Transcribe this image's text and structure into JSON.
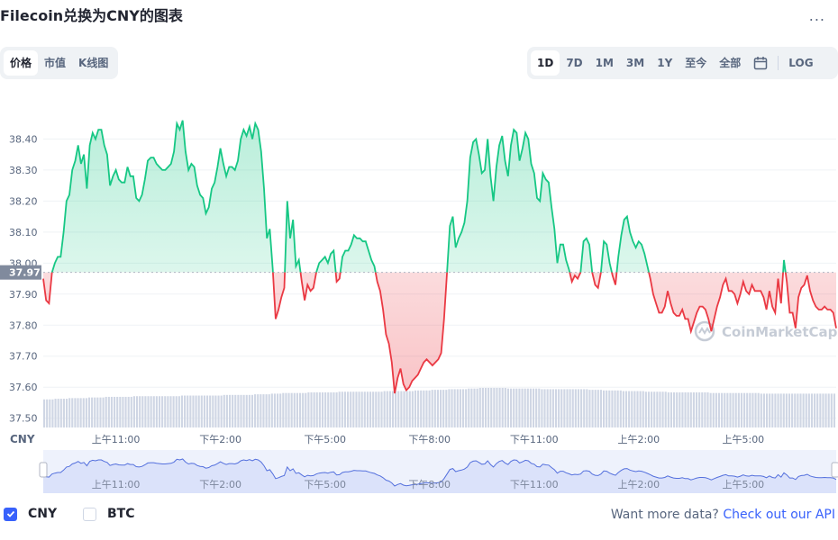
{
  "header": {
    "title": "Filecoin兑换为CNY的图表",
    "more_label": "..."
  },
  "tabs_left": [
    "价格",
    "市值",
    "K线图"
  ],
  "tabs_left_active": 0,
  "tabs_right": [
    "1D",
    "7D",
    "1M",
    "3M",
    "1Y",
    "至今",
    "全部"
  ],
  "tabs_right_active": 0,
  "calendar_icon": "calendar-icon",
  "log_label": "LOG",
  "watermark": "CoinMarketCap",
  "legend": {
    "cny_label": "CNY",
    "btc_label": "BTC",
    "cny_checked": true,
    "btc_checked": false
  },
  "footer": {
    "prompt": "Want more data?",
    "link": "Check out our API"
  },
  "colors": {
    "up": "#16c784",
    "down": "#ea3943",
    "nav_line": "#5470dd",
    "nav_fill": "#e4e9fb",
    "accent": "#3861fb"
  },
  "chart_data": {
    "type": "line",
    "y_axis_unit": "CNY",
    "yticks": [
      "38.40",
      "38.30",
      "38.20",
      "38.10",
      "38.00",
      "37.90",
      "37.80",
      "37.70",
      "37.60",
      "37.50"
    ],
    "ylim": [
      37.47,
      38.5
    ],
    "reference_price": 37.97,
    "reference_label": "37.97",
    "x_labels": [
      "上午11:00",
      "下午2:00",
      "下午5:00",
      "下午8:00",
      "下午11:00",
      "上午2:00",
      "上午5:00"
    ],
    "x_label_index": [
      25,
      61,
      97,
      133,
      169,
      205,
      241
    ],
    "price_series": [
      37.95,
      37.88,
      37.87,
      37.97,
      38.0,
      38.02,
      38.02,
      38.1,
      38.2,
      38.22,
      38.3,
      38.33,
      38.38,
      38.32,
      38.35,
      38.24,
      38.38,
      38.42,
      38.4,
      38.43,
      38.43,
      38.38,
      38.35,
      38.25,
      38.28,
      38.3,
      38.27,
      38.26,
      38.26,
      38.31,
      38.28,
      38.28,
      38.21,
      38.2,
      38.22,
      38.27,
      38.33,
      38.34,
      38.34,
      38.32,
      38.31,
      38.3,
      38.3,
      38.31,
      38.32,
      38.36,
      38.45,
      38.43,
      38.46,
      38.36,
      38.3,
      38.32,
      38.31,
      38.25,
      38.22,
      38.21,
      38.16,
      38.18,
      38.24,
      38.26,
      38.31,
      38.37,
      38.32,
      38.28,
      38.31,
      38.31,
      38.3,
      38.33,
      38.4,
      38.43,
      38.41,
      38.44,
      38.4,
      38.45,
      38.43,
      38.36,
      38.24,
      38.08,
      38.11,
      37.98,
      37.82,
      37.85,
      37.89,
      37.92,
      38.2,
      38.08,
      38.14,
      37.99,
      38.01,
      37.94,
      37.88,
      37.93,
      37.91,
      37.92,
      37.97,
      38.0,
      38.01,
      38.02,
      38.0,
      38.03,
      38.04,
      37.94,
      37.95,
      38.02,
      38.04,
      38.04,
      38.06,
      38.09,
      38.08,
      38.08,
      38.07,
      38.07,
      38.04,
      38.01,
      37.99,
      37.94,
      37.91,
      37.85,
      37.77,
      37.74,
      37.68,
      37.58,
      37.63,
      37.66,
      37.61,
      37.59,
      37.6,
      37.62,
      37.63,
      37.64,
      37.66,
      37.68,
      37.69,
      37.68,
      37.67,
      37.68,
      37.69,
      37.71,
      37.82,
      37.97,
      38.12,
      38.15,
      38.05,
      38.08,
      38.1,
      38.13,
      38.2,
      38.34,
      38.39,
      38.4,
      38.35,
      38.29,
      38.3,
      38.4,
      38.28,
      38.2,
      38.31,
      38.38,
      38.41,
      38.33,
      38.28,
      38.38,
      38.43,
      38.42,
      38.33,
      38.37,
      38.42,
      38.4,
      38.32,
      38.29,
      38.21,
      38.2,
      38.29,
      38.27,
      38.26,
      38.18,
      38.11,
      38.0,
      38.06,
      38.06,
      38.01,
      37.98,
      37.94,
      37.96,
      37.95,
      37.97,
      38.07,
      38.08,
      38.06,
      37.97,
      37.93,
      37.92,
      37.97,
      38.07,
      38.06,
      38.0,
      37.96,
      37.93,
      38.02,
      38.09,
      38.14,
      38.15,
      38.1,
      38.07,
      38.05,
      38.07,
      38.06,
      38.03,
      37.99,
      37.95,
      37.9,
      37.87,
      37.84,
      37.84,
      37.86,
      37.91,
      37.87,
      37.84,
      37.83,
      37.83,
      37.85,
      37.82,
      37.82,
      37.78,
      37.81,
      37.84,
      37.86,
      37.86,
      37.85,
      37.82,
      37.78,
      37.82,
      37.86,
      37.89,
      37.93,
      37.95,
      37.91,
      37.91,
      37.9,
      37.87,
      37.9,
      37.94,
      37.91,
      37.9,
      37.93,
      37.91,
      37.91,
      37.91,
      37.89,
      37.85,
      37.91,
      37.86,
      37.84,
      37.95,
      37.87,
      38.01,
      37.94,
      37.84,
      37.84,
      37.79,
      37.89,
      37.92,
      37.93,
      37.96,
      37.91,
      37.88,
      37.86,
      37.85,
      37.85,
      37.86,
      37.85,
      37.85,
      37.84,
      37.79
    ],
    "volume_series": [
      44,
      44,
      44,
      44,
      45,
      45,
      45,
      45,
      45,
      46,
      46,
      46,
      46,
      46,
      46,
      46,
      47,
      47,
      47,
      47,
      47,
      47,
      48,
      48,
      48,
      48,
      48,
      48,
      48,
      48,
      48,
      48,
      49,
      49,
      49,
      49,
      49,
      49,
      49,
      49,
      49,
      49,
      49,
      49,
      49,
      49,
      49,
      49,
      49,
      50,
      50,
      50,
      50,
      50,
      50,
      50,
      50,
      50,
      50,
      50,
      50,
      50,
      50,
      50,
      51,
      51,
      51,
      51,
      51,
      51,
      51,
      51,
      51,
      51,
      51,
      52,
      52,
      52,
      52,
      52,
      52,
      53,
      53,
      53,
      53,
      54,
      54,
      54,
      54,
      54,
      54,
      54,
      54,
      54,
      55,
      55,
      55,
      55,
      55,
      55,
      55,
      55,
      55,
      55,
      55,
      56,
      56,
      56,
      56,
      56,
      56,
      56,
      56,
      56,
      56,
      56,
      56,
      56,
      56,
      56,
      56,
      57,
      57,
      57,
      57,
      57,
      57,
      57,
      57,
      57,
      57,
      57,
      58,
      58,
      58,
      58,
      58,
      58,
      59,
      59,
      59,
      59,
      59,
      59,
      60,
      60,
      60,
      60,
      60,
      60,
      60,
      61,
      61,
      61,
      61,
      62,
      62,
      62,
      62,
      62,
      62,
      62,
      62,
      62,
      62,
      61,
      61,
      61,
      61,
      61,
      61,
      61,
      61,
      61,
      61,
      61,
      61,
      60,
      60,
      60,
      60,
      60,
      60,
      60,
      60,
      60,
      60,
      60,
      60,
      60,
      60,
      60,
      60,
      60,
      59,
      59,
      59,
      59,
      59,
      58,
      58,
      58,
      58,
      58,
      58,
      58,
      57,
      57,
      57,
      57,
      57,
      57,
      57,
      57,
      56,
      56,
      56,
      56,
      56,
      56,
      56,
      56,
      55,
      55,
      55,
      55,
      55,
      55,
      55,
      55,
      55,
      55,
      55,
      55,
      55,
      55,
      55,
      54,
      54,
      54,
      54,
      54,
      54,
      54,
      54,
      54,
      54,
      54,
      54,
      54,
      54,
      54,
      54,
      54,
      54,
      53,
      53,
      53,
      53,
      53,
      53,
      53,
      53,
      53,
      53,
      53,
      53,
      53,
      53,
      53,
      53,
      53,
      53,
      53,
      53,
      53,
      53,
      53,
      53,
      53,
      53,
      53
    ],
    "navigator_labels": [
      "上午11:00",
      "下午2:00",
      "下午5:00",
      "下午8:00",
      "下午11:00",
      "上午2:00",
      "上午5:00"
    ]
  }
}
